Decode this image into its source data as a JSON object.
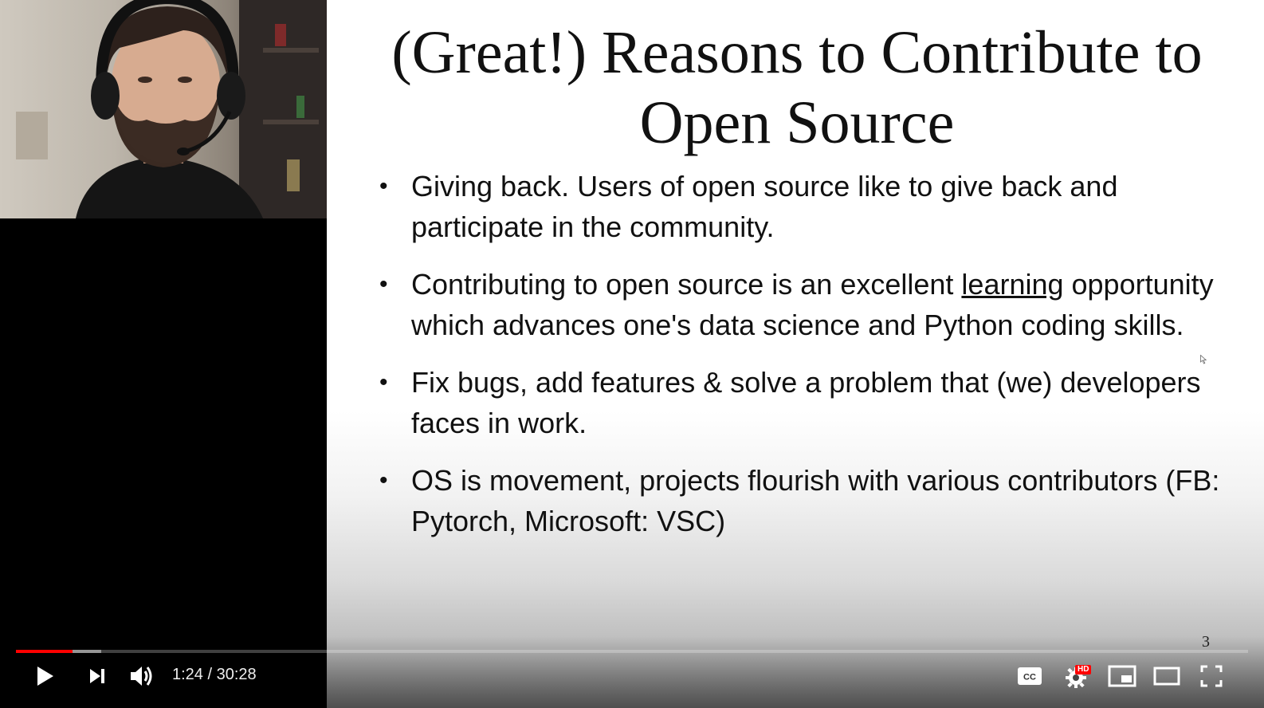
{
  "slide": {
    "title": "(Great!) Reasons to Contribute to Open Source",
    "bullet_glyph": "•",
    "bullets": [
      {
        "before": "Giving back. Users of open source like to give back and participate in the community.",
        "underlined": "",
        "after": ""
      },
      {
        "before": "Contributing to open source is an excellent ",
        "underlined": "learning",
        "after": " opportunity which advances one's data science and Python coding skills."
      },
      {
        "before": "Fix bugs, add features & solve a problem that (we) developers faces in work.",
        "underlined": "",
        "after": ""
      },
      {
        "before": "OS is movement, projects flourish with various contributors (FB: Pytorch, Microsoft: VSC)",
        "underlined": "",
        "after": ""
      }
    ],
    "page_number": "3"
  },
  "player": {
    "time_display": "1:24 / 30:28",
    "played_fraction": 0.046,
    "buffered_fraction": 0.069,
    "hd_badge": "HD",
    "accent_color": "#ff0000",
    "icons": {
      "play": "play-icon",
      "next": "next-icon",
      "volume": "volume-icon",
      "captions": "captions-icon",
      "settings": "settings-gear-icon",
      "miniplayer": "miniplayer-icon",
      "theater": "theater-mode-icon",
      "fullscreen": "fullscreen-icon"
    }
  }
}
